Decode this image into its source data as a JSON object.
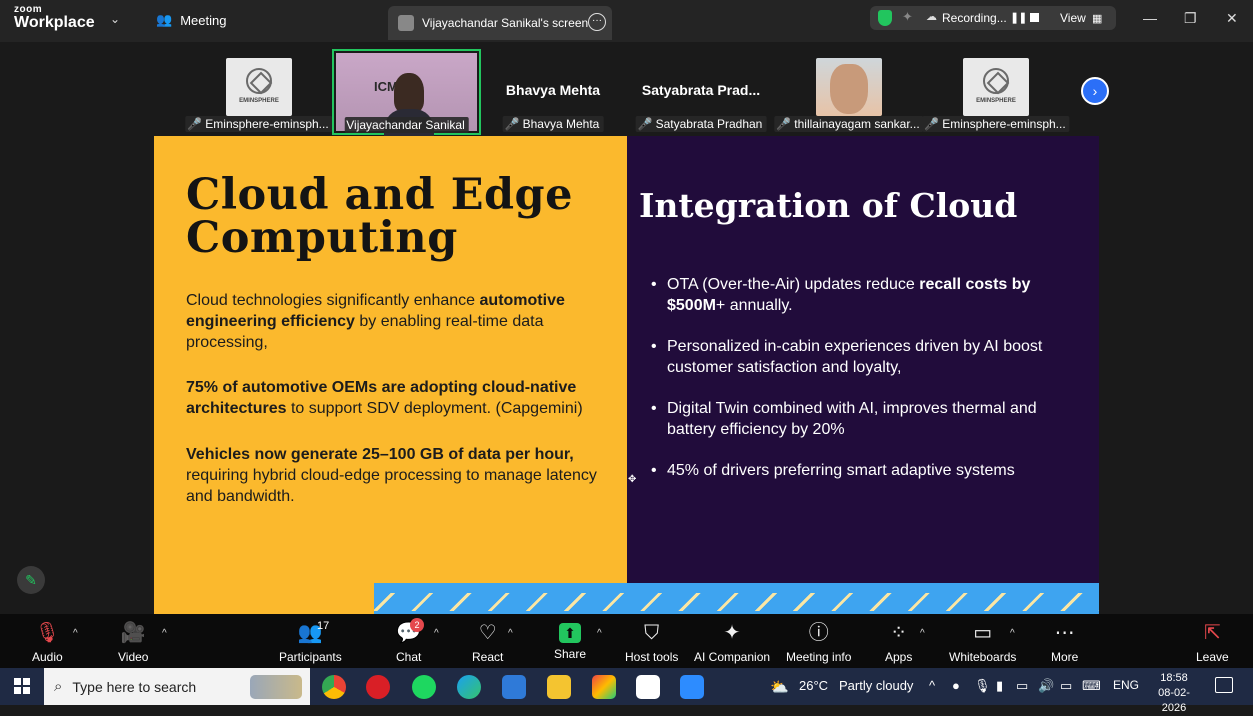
{
  "titlebar": {
    "brand_top": "zoom",
    "brand_bottom": "Workplace",
    "meeting_label": "Meeting",
    "tab_label": "Vijayachandar Sanikal's screen",
    "recording_label": "Recording...",
    "view_label": "View"
  },
  "participants_strip": [
    {
      "kind": "logo",
      "logo_text": "EMINSPHERE",
      "label": "Eminsphere-eminsph..."
    },
    {
      "kind": "speaker",
      "slide_text": "ICM 26",
      "label": "Vijayachandar Sanikal"
    },
    {
      "kind": "name",
      "big_name": "Bhavya Mehta",
      "label": "Bhavya Mehta"
    },
    {
      "kind": "name",
      "big_name": "Satyabrata  Prad...",
      "label": "Satyabrata Pradhan"
    },
    {
      "kind": "photo",
      "label": "thillainayagam sankar..."
    },
    {
      "kind": "logo",
      "logo_text": "EMINSPHERE",
      "label": "Eminsphere-eminsph..."
    }
  ],
  "slide": {
    "left_title_line1": "Cloud and Edge",
    "left_title_line2": "Computing",
    "p1_a": "Cloud technologies significantly enhance ",
    "p1_b": "automotive engineering efficiency",
    "p1_c": " by enabling real-time data processing,",
    "p2_a": "75% of automotive OEMs are adopting cloud-native architectures",
    "p2_b": " to support SDV deployment. (Capgemini)",
    "p3_a": "Vehicles now generate 25–100 GB of data per hour,",
    "p3_b": " requiring hybrid cloud-edge processing to manage latency and bandwidth.",
    "right_title": "Integration of Cloud",
    "b1_a": "OTA (Over-the-Air) updates reduce ",
    "b1_b": "recall costs by $500M",
    "b1_c": "+ annually.",
    "b2": "Personalized in-cabin experiences driven by AI boost customer satisfaction and loyalty,",
    "b3": "Digital Twin combined with AI, improves thermal and battery efficiency by 20%",
    "b4": "45% of drivers preferring smart adaptive systems"
  },
  "toolbar": {
    "audio": "Audio",
    "video": "Video",
    "participants": "Participants",
    "participants_count": "17",
    "chat": "Chat",
    "chat_badge": "2",
    "react": "React",
    "share": "Share",
    "host_tools": "Host tools",
    "ai_companion": "AI Companion",
    "meeting_info": "Meeting info",
    "apps": "Apps",
    "whiteboards": "Whiteboards",
    "more": "More",
    "leave": "Leave"
  },
  "taskbar": {
    "search_placeholder": "Type here to search",
    "weather_temp": "26°C",
    "weather_desc": "Partly cloudy",
    "lang": "ENG",
    "time": "18:58",
    "date": "08-02-2026"
  },
  "colors": {
    "slide_left_bg": "#fbb92d",
    "slide_right_bg": "#210c3b",
    "accent_green": "#22c55e",
    "accent_blue": "#2b6ff7"
  }
}
